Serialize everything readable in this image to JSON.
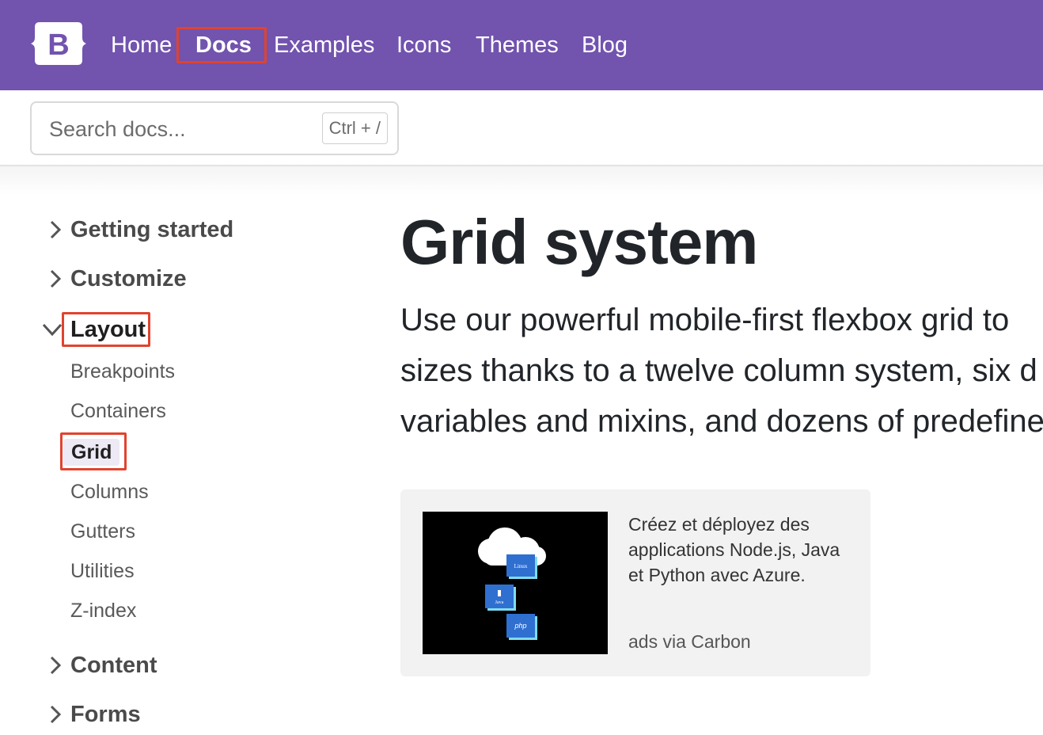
{
  "navbar": {
    "brand_letter": "B",
    "links": [
      {
        "label": "Home",
        "active": false
      },
      {
        "label": "Docs",
        "active": true
      },
      {
        "label": "Examples",
        "active": false
      },
      {
        "label": "Icons",
        "active": false
      },
      {
        "label": "Themes",
        "active": false
      },
      {
        "label": "Blog",
        "active": false
      }
    ]
  },
  "search": {
    "placeholder": "Search docs...",
    "shortcut": "Ctrl + /"
  },
  "sidebar": {
    "sections": [
      {
        "label": "Getting started",
        "expanded": false
      },
      {
        "label": "Customize",
        "expanded": false
      },
      {
        "label": "Layout",
        "expanded": true,
        "items": [
          "Breakpoints",
          "Containers",
          "Grid",
          "Columns",
          "Gutters",
          "Utilities",
          "Z-index"
        ],
        "active_item": "Grid"
      },
      {
        "label": "Content",
        "expanded": false
      },
      {
        "label": "Forms",
        "expanded": false
      }
    ]
  },
  "main": {
    "title": "Grid system",
    "lead_lines": [
      "Use our powerful mobile-first flexbox grid to",
      "sizes thanks to a twelve column system, six d",
      "variables and mixins, and dozens of predefine"
    ]
  },
  "ad": {
    "text": "Créez et déployez des applications Node.js, Java et Python avec Azure.",
    "credit": "ads via Carbon",
    "badges": [
      "Linux",
      "Java",
      "php"
    ]
  },
  "colors": {
    "navbar_bg": "#7253ae",
    "highlight": "#e0432f"
  }
}
